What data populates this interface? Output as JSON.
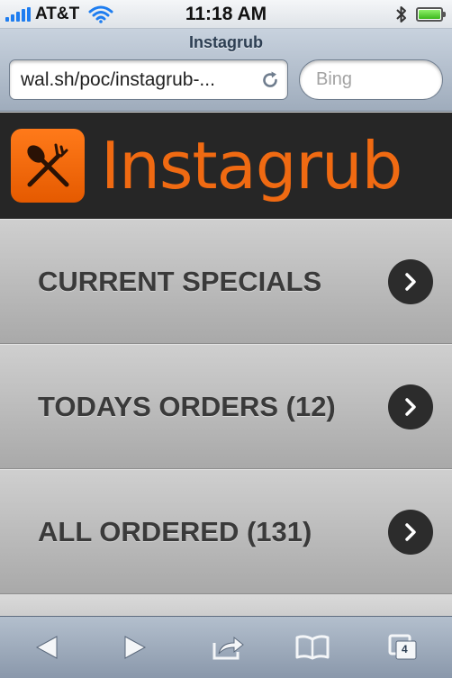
{
  "status_bar": {
    "carrier": "AT&T",
    "time": "11:18 AM"
  },
  "browser": {
    "page_title": "Instagrub",
    "url": "wal.sh/poc/instagrub-...",
    "search_placeholder": "Bing",
    "open_tabs": "4"
  },
  "app": {
    "name": "Instagrub",
    "brand_color": "#f06a12"
  },
  "menu": {
    "items": [
      {
        "label": "CURRENT SPECIALS"
      },
      {
        "label": "TODAYS ORDERS (12)"
      },
      {
        "label": "ALL ORDERED (131)"
      }
    ]
  },
  "toolbar": {
    "icons": [
      "back-icon",
      "forward-icon",
      "share-icon",
      "bookmarks-icon",
      "tabs-icon"
    ]
  }
}
